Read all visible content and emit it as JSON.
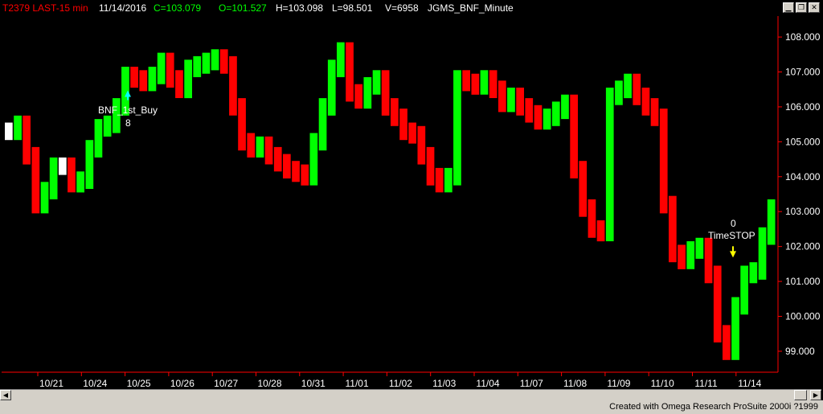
{
  "header": {
    "symbol": "T2379 LAST-15 min",
    "date": "11/14/2016",
    "close": "C=103.079",
    "open": "O=101.527",
    "high": "H=103.098",
    "low": "L=98.501",
    "volume": "V=6958",
    "study": "JGMS_BNF_Minute"
  },
  "window_controls": [
    "minimize",
    "restore",
    "close"
  ],
  "footer": {
    "credit": "Created with Omega Research ProSuite 2000i ?1999"
  },
  "colors": {
    "up": "#00ff00",
    "down": "#ff0000",
    "neutral": "#ffffff",
    "entry_arrow": "#00ffff",
    "exit_arrow": "#ffff00",
    "header_symbol": "#ff0000",
    "header_ohlc": "#00ff00"
  },
  "chart_data": {
    "type": "bar",
    "subtype": "ohlc-price-chart",
    "y_axis": {
      "side": "right",
      "ticks": [
        "108.000",
        "107.000",
        "106.000",
        "105.000",
        "104.000",
        "103.000",
        "102.000",
        "101.000",
        "100.000",
        "99.000"
      ],
      "ylim": [
        98.4,
        108.6
      ]
    },
    "x_axis": {
      "ticks": [
        "10/21",
        "10/24",
        "10/25",
        "10/26",
        "10/27",
        "10/28",
        "10/31",
        "11/01",
        "11/02",
        "11/03",
        "11/04",
        "11/07",
        "11/08",
        "11/09",
        "11/10",
        "11/11",
        "11/14"
      ]
    },
    "grid": false,
    "series": [
      {
        "values": [
          105.3,
          105.5,
          104.6,
          103.2,
          103.6,
          104.3,
          104.3,
          103.8,
          103.9,
          104.8,
          105.4,
          105.5,
          106.0,
          106.9,
          106.8,
          106.7,
          106.9,
          107.3,
          106.8,
          106.5,
          107.1,
          107.2,
          107.3,
          107.4,
          107.2,
          106.0,
          105.0,
          104.8,
          104.9,
          104.6,
          104.4,
          104.2,
          104.1,
          104.0,
          105.0,
          106.0,
          107.1,
          107.6,
          106.4,
          106.2,
          106.6,
          106.8,
          106.0,
          105.7,
          105.3,
          105.2,
          104.6,
          104.0,
          103.8,
          104.0,
          106.8,
          106.7,
          106.6,
          106.8,
          106.5,
          106.1,
          106.3,
          106.0,
          105.8,
          105.6,
          105.7,
          105.9,
          106.1,
          104.2,
          103.1,
          102.5,
          102.4,
          106.3,
          106.5,
          106.7,
          106.3,
          106.0,
          105.7,
          103.2,
          101.8,
          101.6,
          101.9,
          102.0,
          101.2,
          99.5,
          99.0,
          100.3,
          101.2,
          101.3,
          102.3,
          103.1
        ]
      }
    ],
    "annotations": [
      {
        "text": "BNF_1st_Buy",
        "type": "buy-arrow"
      },
      {
        "text": "8"
      },
      {
        "text": "0"
      },
      {
        "text": "TimeSTOP",
        "type": "exit-arrow"
      }
    ]
  }
}
